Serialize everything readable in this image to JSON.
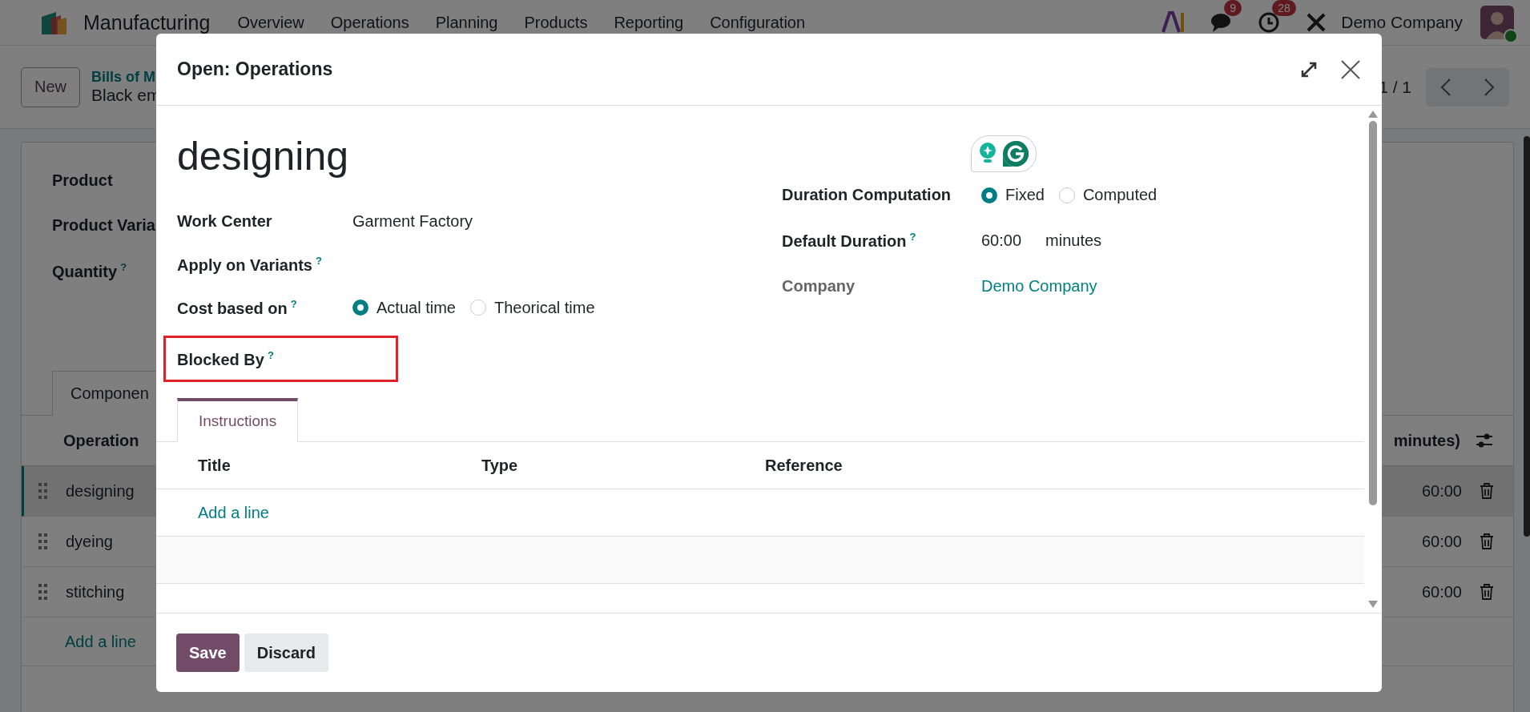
{
  "navbar": {
    "app_name": "Manufacturing",
    "menus": [
      "Overview",
      "Operations",
      "Planning",
      "Products",
      "Reporting",
      "Configuration"
    ],
    "messages_badge": "9",
    "activities_badge": "28",
    "company": "Demo Company"
  },
  "control_panel": {
    "new_button": "New",
    "breadcrumb": "Bills of M",
    "record": "Black em",
    "pager": "1 / 1"
  },
  "form": {
    "fields": [
      {
        "label": "Product"
      },
      {
        "label": "Product Varia"
      },
      {
        "label": "Quantity",
        "help": "?"
      }
    ],
    "tab": "Componen",
    "operations": {
      "header": "Operation",
      "header_right": "minutes)",
      "rows": [
        {
          "name": "designing",
          "duration": "60:00",
          "selected": true
        },
        {
          "name": "dyeing",
          "duration": "60:00",
          "selected": false
        },
        {
          "name": "stitching",
          "duration": "60:00",
          "selected": false
        }
      ],
      "add_line": "Add a line"
    }
  },
  "dialog": {
    "title": "Open: Operations",
    "name": "designing",
    "left_fields": [
      {
        "kind": "text",
        "label": "Work Center",
        "value": "Garment Factory",
        "highlighted": false
      },
      {
        "kind": "empty",
        "label": "Apply on Variants",
        "help": "?",
        "highlighted": false
      },
      {
        "kind": "radio",
        "label": "Cost based on",
        "help": "?",
        "options": [
          {
            "label": "Actual time",
            "selected": true
          },
          {
            "label": "Theorical time",
            "selected": false
          }
        ],
        "highlighted": false
      },
      {
        "kind": "empty",
        "label": "Blocked By",
        "help": "?",
        "highlighted": true
      }
    ],
    "right_fields": [
      {
        "kind": "radio",
        "label": "Duration Computation",
        "options": [
          {
            "label": "Fixed",
            "selected": true
          },
          {
            "label": "Computed",
            "selected": false
          }
        ],
        "muted": false
      },
      {
        "kind": "duration",
        "label": "Default Duration",
        "help": "?",
        "value": "60:00",
        "unit": "minutes",
        "muted": false
      },
      {
        "kind": "link",
        "label": "Company",
        "value": "Demo Company",
        "muted": true
      }
    ],
    "tabs": [
      {
        "label": "Instructions",
        "selected": true
      }
    ],
    "columns": [
      "Title",
      "Type",
      "Reference"
    ],
    "add_line": "Add a line",
    "buttons": [
      {
        "label": "Save",
        "kind": "primary"
      },
      {
        "label": "Discard",
        "kind": "secondary"
      }
    ]
  }
}
